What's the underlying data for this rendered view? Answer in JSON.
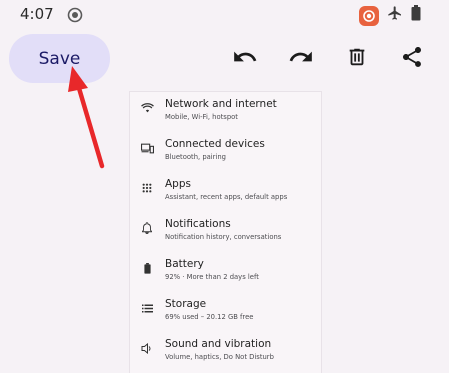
{
  "status_bar": {
    "time": "4:07"
  },
  "toolbar": {
    "save_label": "Save",
    "icons": [
      "undo-icon",
      "redo-icon",
      "trash-icon",
      "share-icon"
    ],
    "save_bg": "#e2def8",
    "save_text_color": "#1b1a66"
  },
  "annotation": {
    "arrow_color": "#e8282a"
  },
  "settings": {
    "items": [
      {
        "title": "Network and internet",
        "subtitle": "Mobile, Wi-Fi, hotspot",
        "icon": "wifi-icon"
      },
      {
        "title": "Connected devices",
        "subtitle": "Bluetooth, pairing",
        "icon": "devices-icon"
      },
      {
        "title": "Apps",
        "subtitle": "Assistant, recent apps, default apps",
        "icon": "apps-grid-icon"
      },
      {
        "title": "Notifications",
        "subtitle": "Notification history, conversations",
        "icon": "bell-icon"
      },
      {
        "title": "Battery",
        "subtitle": "92% · More than 2 days left",
        "icon": "battery-icon"
      },
      {
        "title": "Storage",
        "subtitle": "69% used – 20.12 GB free",
        "icon": "storage-icon"
      },
      {
        "title": "Sound and vibration",
        "subtitle": "Volume, haptics, Do Not Disturb",
        "icon": "volume-icon"
      }
    ]
  }
}
